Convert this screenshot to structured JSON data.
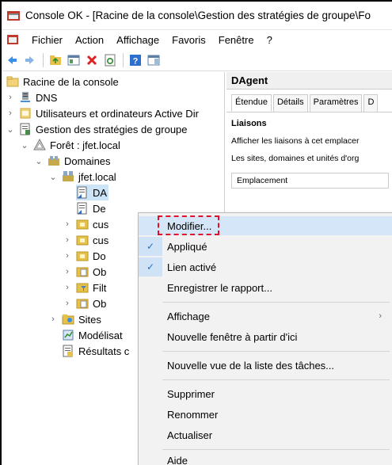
{
  "window": {
    "title": "Console OK - [Racine de la console\\Gestion des stratégies de groupe\\Fo"
  },
  "menubar": {
    "items": [
      "Fichier",
      "Action",
      "Affichage",
      "Favoris",
      "Fenêtre",
      "?"
    ]
  },
  "tree": {
    "root": "Racine de la console",
    "dns": "DNS",
    "users": "Utilisateurs et ordinateurs Active Dir",
    "gpm": "Gestion des stratégies de groupe",
    "forest": "Forêt : jfet.local",
    "domains": "Domaines",
    "domain": "jfet.local",
    "child1": "DA",
    "child2": "De",
    "child3": "cus",
    "child4": "cus",
    "child5": "Do",
    "child6": "Ob",
    "child7": "Filt",
    "child8": "Ob",
    "sites": "Sites",
    "modeling": "Modélisat",
    "results": "Résultats c"
  },
  "right_pane": {
    "header": "DAgent",
    "tabs": [
      "Étendue",
      "Détails",
      "Paramètres",
      "D"
    ],
    "section": "Liaisons",
    "line1": "Afficher les liaisons à cet emplacer",
    "line2": "Les sites, domaines et unités d'org",
    "column": "Emplacement"
  },
  "context_menu": {
    "items": {
      "modifier": "Modifier...",
      "applique": "Appliqué",
      "lien": "Lien activé",
      "enregistrer": "Enregistrer le rapport...",
      "affichage": "Affichage",
      "nouvelle_fenetre": "Nouvelle fenêtre à partir d'ici",
      "nouvelle_vue": "Nouvelle vue de la liste des tâches...",
      "supprimer": "Supprimer",
      "renommer": "Renommer",
      "actualiser": "Actualiser",
      "aide": "Aide"
    },
    "check_glyph": "✓",
    "submenu_glyph": "›"
  },
  "colors": {
    "highlight": "#d4e6f7",
    "annotation": "#e0102a",
    "check": "#1a73c9"
  }
}
